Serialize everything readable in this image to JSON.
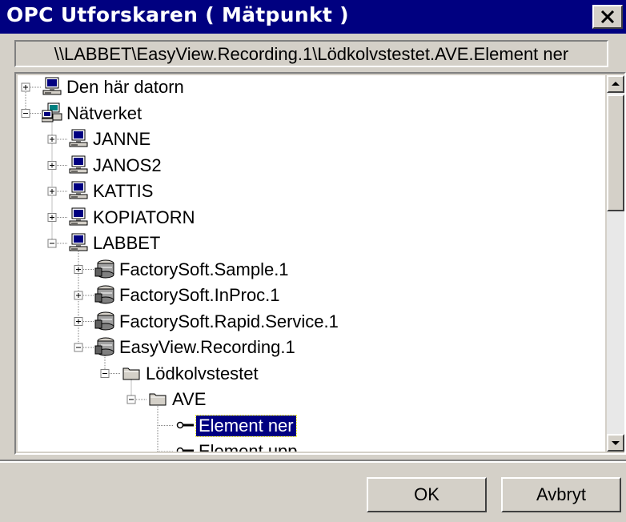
{
  "window": {
    "title": "OPC Utforskaren ( Mätpunkt )",
    "close_icon": "close-icon"
  },
  "path": "\\\\LABBET\\EasyView.Recording.1\\Lödkolvstestet.AVE.Element ner",
  "tree": {
    "items": [
      {
        "label": "Den här datorn",
        "icon": "computer-icon",
        "expander": "plus"
      },
      {
        "label": "Nätverket",
        "icon": "network-icon",
        "expander": "minus"
      },
      {
        "label": "JANNE",
        "icon": "computer-icon",
        "expander": "plus"
      },
      {
        "label": "JANOS2",
        "icon": "computer-icon",
        "expander": "plus"
      },
      {
        "label": "KATTIS",
        "icon": "computer-icon",
        "expander": "plus"
      },
      {
        "label": "KOPIATORN",
        "icon": "computer-icon",
        "expander": "plus"
      },
      {
        "label": "LABBET",
        "icon": "computer-icon",
        "expander": "minus"
      },
      {
        "label": "FactorySoft.Sample.1",
        "icon": "server-icon",
        "expander": "plus"
      },
      {
        "label": "FactorySoft.InProc.1",
        "icon": "server-icon",
        "expander": "plus"
      },
      {
        "label": "FactorySoft.Rapid.Service.1",
        "icon": "server-icon",
        "expander": "plus"
      },
      {
        "label": "EasyView.Recording.1",
        "icon": "server-icon",
        "expander": "minus"
      },
      {
        "label": "Lödkolvstestet",
        "icon": "folder-icon",
        "expander": "minus"
      },
      {
        "label": "AVE",
        "icon": "folder-icon",
        "expander": "minus"
      },
      {
        "label": "Element ner",
        "icon": "tag-icon",
        "expander": "none",
        "selected": true
      },
      {
        "label": "Element upp",
        "icon": "tag-icon",
        "expander": "none"
      }
    ]
  },
  "buttons": {
    "ok": "OK",
    "cancel": "Avbryt"
  },
  "colors": {
    "titlebar": "#000080",
    "face": "#d4d0c8",
    "selection": "#000080"
  }
}
